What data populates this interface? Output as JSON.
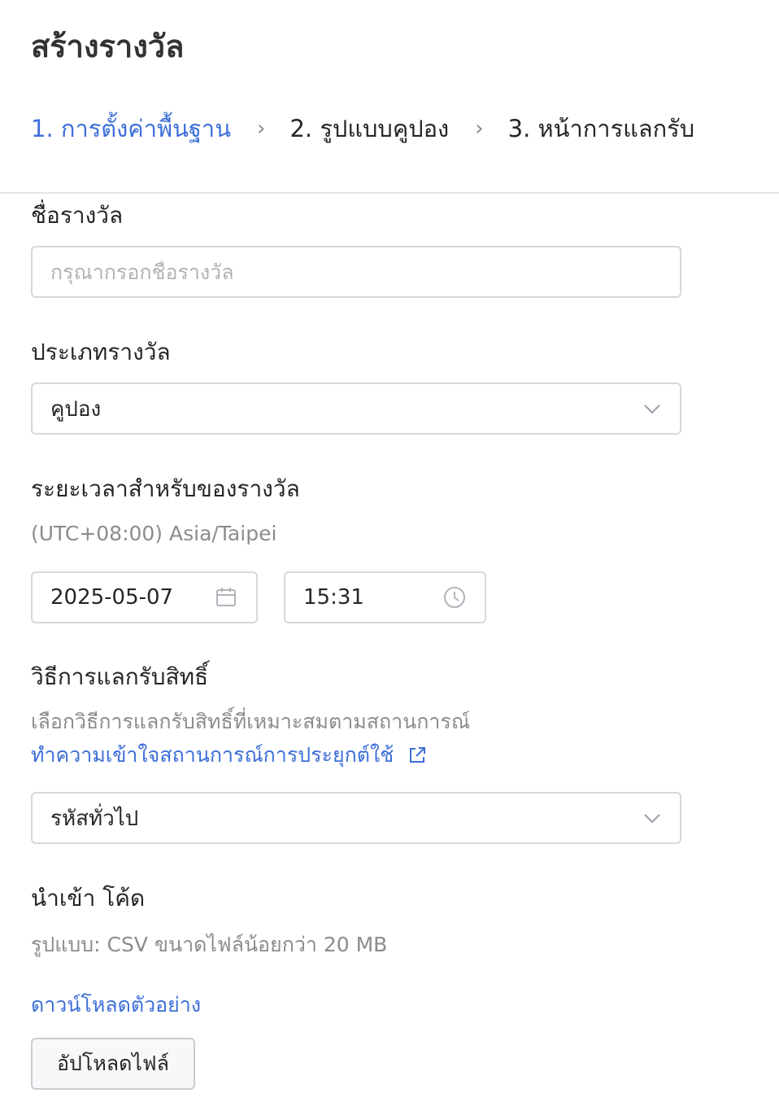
{
  "page": {
    "title": "สร้างรางวัล"
  },
  "steps": [
    {
      "label": "1. การตั้งค่าพื้นฐาน"
    },
    {
      "label": "2. รูปแบบคูปอง"
    },
    {
      "label": "3. หน้าการแลกรับ"
    }
  ],
  "step_separator": "›",
  "reward_name": {
    "label": "ชื่อรางวัล",
    "value": "",
    "placeholder": "กรุณากรอกชื่อรางวัล"
  },
  "reward_type": {
    "label": "ประเภทรางวัล",
    "value": "คูปอง"
  },
  "validity": {
    "label": "ระยะเวลาสำหรับของรางวัล",
    "timezone": "(UTC+08:00) Asia/Taipei",
    "date": "2025-05-07",
    "time": "15:31"
  },
  "redemption": {
    "label": "วิธีการแลกรับสิทธิ์",
    "hint": "เลือกวิธีการแลกรับสิทธิ์ที่เหมาะสมตามสถานการณ์",
    "link": "ทำความเข้าใจสถานการณ์การประยุกต์ใช้",
    "value": "รหัสทั่วไป"
  },
  "import": {
    "label": "นำเข้า โค้ด",
    "hint": "รูปแบบ: CSV ขนาดไฟล์น้อยกว่า 20 MB",
    "download_link": "ดาวน์โหลดตัวอย่าง",
    "upload_button": "อัปโหลดไฟล์"
  },
  "colors": {
    "accent": "#3d6fd8",
    "text": "#262626",
    "muted": "#8c8c8c",
    "border": "#d5d8dc"
  },
  "icons": {
    "chevron": "chevron-down-icon",
    "calendar": "calendar-icon",
    "clock": "clock-icon",
    "external": "external-link-icon"
  }
}
